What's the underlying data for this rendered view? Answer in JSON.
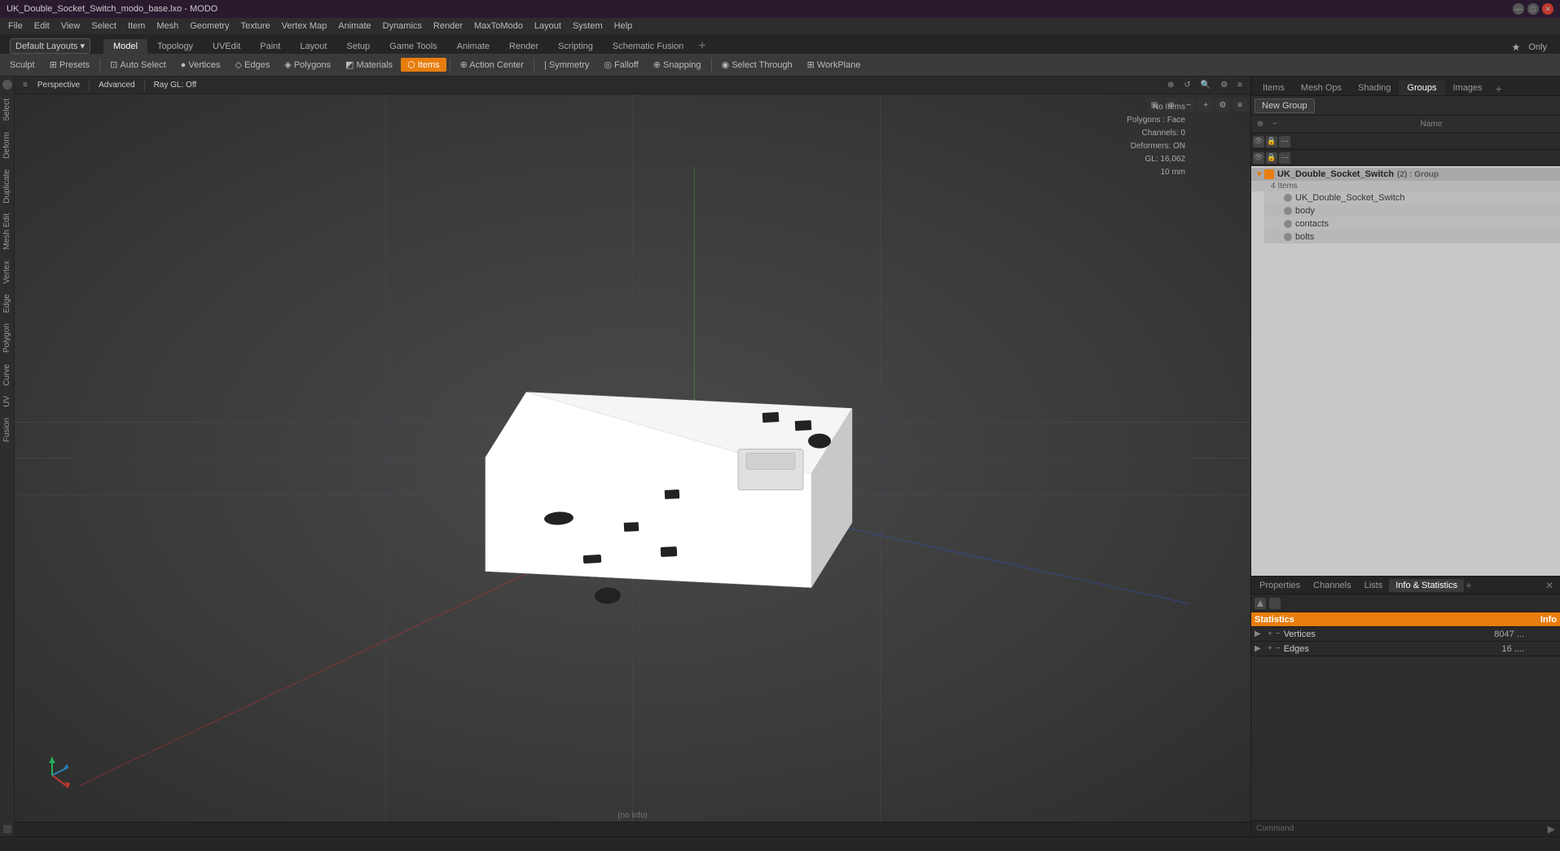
{
  "titlebar": {
    "title": "UK_Double_Socket_Switch_modo_base.lxo - MODO",
    "win_min": "—",
    "win_max": "□",
    "win_close": "✕"
  },
  "menubar": {
    "items": [
      "File",
      "Edit",
      "View",
      "Select",
      "Item",
      "Mesh",
      "Geometry",
      "Texture",
      "Vertex Map",
      "Animate",
      "Dynamics",
      "Render",
      "MaxToModo",
      "Layout",
      "System",
      "Help"
    ]
  },
  "layoutbar": {
    "dropdown_label": "Default Layouts ▾",
    "tabs": [
      "Model",
      "Topology",
      "UVEdit",
      "Paint",
      "Layout",
      "Setup",
      "Game Tools",
      "Animate",
      "Render",
      "Scripting",
      "Schematic Fusion"
    ],
    "active_tab": "Model",
    "plus_btn": "+",
    "only_btn": "Only",
    "star_icon": "★"
  },
  "toolbar": {
    "sculpt_label": "Sculpt",
    "presets_label": "⊞ Presets",
    "auto_select_label": "Auto Select",
    "vertices_label": "● Vertices",
    "edges_label": "◇ Edges",
    "polygons_label": "◈ Polygons",
    "materials_label": "◩ Materials",
    "items_label": "⬡ Items",
    "action_center_label": "⊕ Action Center",
    "symmetry_label": "| Symmetry",
    "falloff_label": "◎ Falloff",
    "snapping_label": "⊕ Snapping",
    "select_through_label": "◉ Select Through",
    "workplane_label": "⊞ WorkPlane"
  },
  "left_sidebar": {
    "tabs": [
      "Select",
      "Deform",
      "Duplicate",
      "Mesh Edit",
      "Vertex",
      "Edge",
      "Polygon",
      "Curve",
      "UV",
      "Fusion"
    ]
  },
  "viewport": {
    "perspective_label": "Perspective",
    "advanced_label": "Advanced",
    "ray_gl_label": "Ray GL: Off",
    "status_text": "(no info)",
    "no_items_label": "No Items",
    "polygons_face_label": "Polygons : Face",
    "channels_label": "Channels: 0",
    "deformers_label": "Deformers: ON",
    "gl_label": "GL: 16,062",
    "size_label": "10 mm"
  },
  "right_panel": {
    "tabs": [
      "Items",
      "Mesh Ops",
      "Shading",
      "Groups",
      "Images"
    ],
    "active_tab": "Groups",
    "plus_btn": "+",
    "new_group_label": "New Group",
    "name_col": "Name",
    "tree": {
      "root": {
        "name": "UK_Double_Socket_Switch",
        "suffix": "(2) : Group",
        "expanded": true,
        "count_label": "4 Items",
        "children": [
          {
            "name": "UK_Double_Socket_Switch",
            "type": "mesh"
          },
          {
            "name": "body",
            "type": "mesh"
          },
          {
            "name": "contacts",
            "type": "mesh"
          },
          {
            "name": "bolts",
            "type": "mesh"
          }
        ]
      }
    }
  },
  "bottom_right": {
    "tabs": [
      "Properties",
      "Channels",
      "Lists",
      "Info & Statistics"
    ],
    "active_tab": "Info & Statistics",
    "plus_btn": "+",
    "stats_header": {
      "statistics_label": "Statistics",
      "info_label": "Info"
    },
    "stats_rows": [
      {
        "expand": true,
        "name": "Vertices",
        "num": "8047 ...",
        "sel": ""
      },
      {
        "expand": false,
        "name": "Edges",
        "num": "16 ....",
        "sel": ""
      }
    ],
    "command_label": "Command"
  },
  "statusbar": {
    "text": ""
  },
  "colors": {
    "accent": "#e87d0d",
    "title_bg": "#2a1a2e",
    "menu_bg": "#2d2d2d",
    "active_tab_bg": "#3a3a3a",
    "toolbar_bg": "#3a3a3a"
  }
}
